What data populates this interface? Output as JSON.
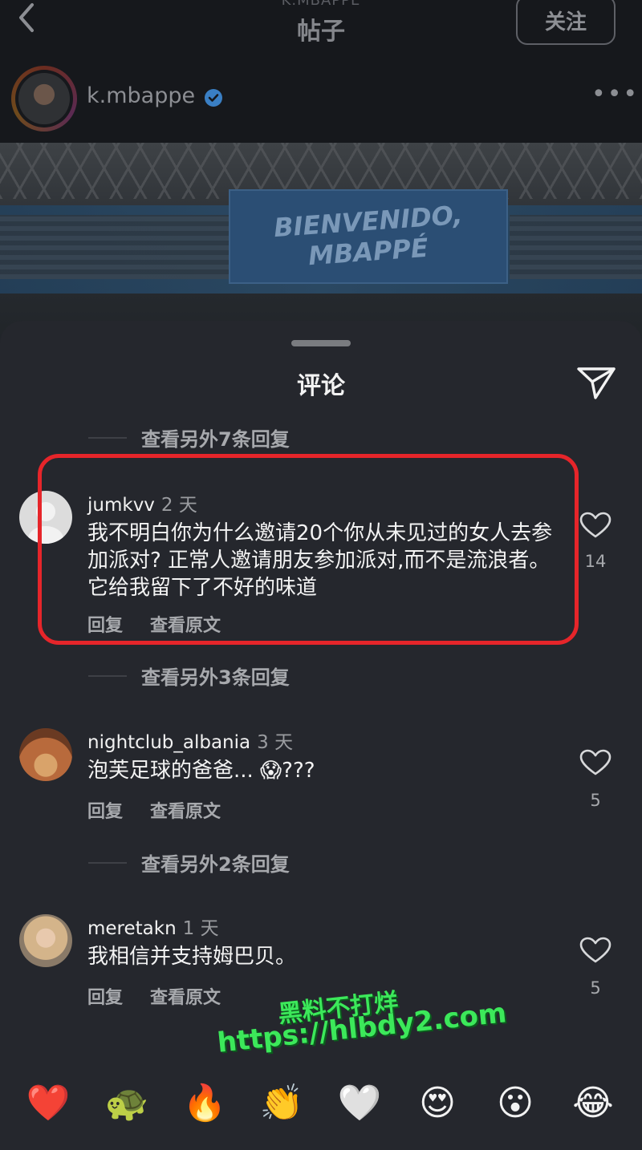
{
  "header": {
    "subtitle": "K.MBAPPE",
    "title": "帖子",
    "follow_label": "关注",
    "username": "k.mbappe",
    "more_glyph": "•••"
  },
  "photo": {
    "banner_line1": "BIENVENIDO,",
    "banner_line2": "MBAPPÉ"
  },
  "sheet": {
    "title": "评论",
    "view_more_1": "查看另外7条回复",
    "view_more_2": "查看另外3条回复",
    "view_more_3": "查看另外2条回复"
  },
  "comments": [
    {
      "user": "jumkvv",
      "age": "2 天",
      "text": "我不明白你为什么邀请20个你从未见过的女人去参加派对? 正常人邀请朋友参加派对,而不是流浪者。 它给我留下了不好的味道",
      "reply": "回复",
      "translate": "查看原文",
      "likes": "14"
    },
    {
      "user": "nightclub_albania",
      "age": "3 天",
      "text": "泡芙足球的爸爸... 😱???",
      "reply": "回复",
      "translate": "查看原文",
      "likes": "5"
    },
    {
      "user": "meretakn",
      "age": "1 天",
      "text": "我相信并支持姆巴贝。",
      "reply": "回复",
      "translate": "查看原文",
      "likes": "5"
    }
  ],
  "watermark": {
    "line1": "黑料不打烊",
    "line2": "https://hlbdy2.com"
  },
  "emoji_bar": [
    "❤️",
    "🐢",
    "🔥",
    "👏",
    "🤍",
    "😍",
    "😮",
    "😂"
  ],
  "colors": {
    "background": "#1b1c20",
    "sheet": "#25272d",
    "highlight": "#e6252a",
    "verified": "#3897f0",
    "watermark": "#3ce85a"
  }
}
